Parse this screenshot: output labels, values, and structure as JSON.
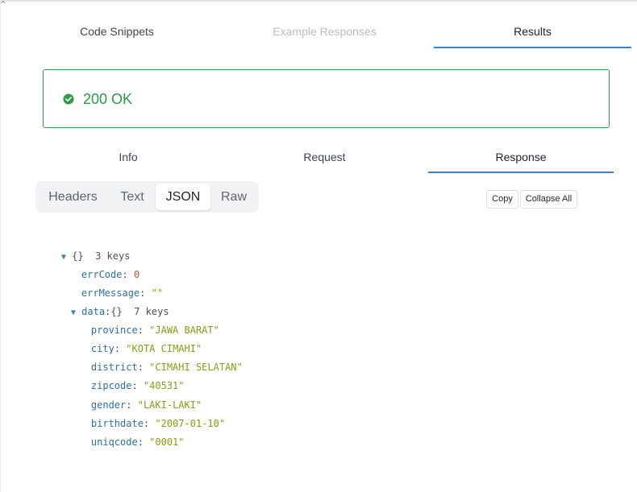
{
  "top_tabs": [
    "Code Snippets",
    "Example Responses",
    "Results"
  ],
  "status": {
    "text": "200 OK",
    "color": "#2c9a48"
  },
  "sub_tabs": [
    "Info",
    "Request",
    "Response"
  ],
  "format_options": [
    "Headers",
    "Text",
    "JSON",
    "Raw"
  ],
  "selected_format": "JSON",
  "buttons": {
    "copy": "Copy",
    "collapse_all": "Collapse All"
  },
  "json_tree": {
    "root_brace": "{}",
    "root_count": "3 keys",
    "err_code": {
      "key": "errCode",
      "value": "0"
    },
    "err_message": {
      "key": "errMessage",
      "value": "\"\""
    },
    "data": {
      "key": "data",
      "brace": "{}",
      "count": "7 keys",
      "fields": [
        {
          "key": "province",
          "value": "\"JAWA BARAT\""
        },
        {
          "key": "city",
          "value": "\"KOTA CIMAHI\""
        },
        {
          "key": "district",
          "value": "\"CIMAHI SELATAN\""
        },
        {
          "key": "zipcode",
          "value": "\"40531\""
        },
        {
          "key": "gender",
          "value": "\"LAKI-LAKI\""
        },
        {
          "key": "birthdate",
          "value": "\"2007-01-10\""
        },
        {
          "key": "uniqcode",
          "value": "\"0001\""
        }
      ]
    }
  }
}
